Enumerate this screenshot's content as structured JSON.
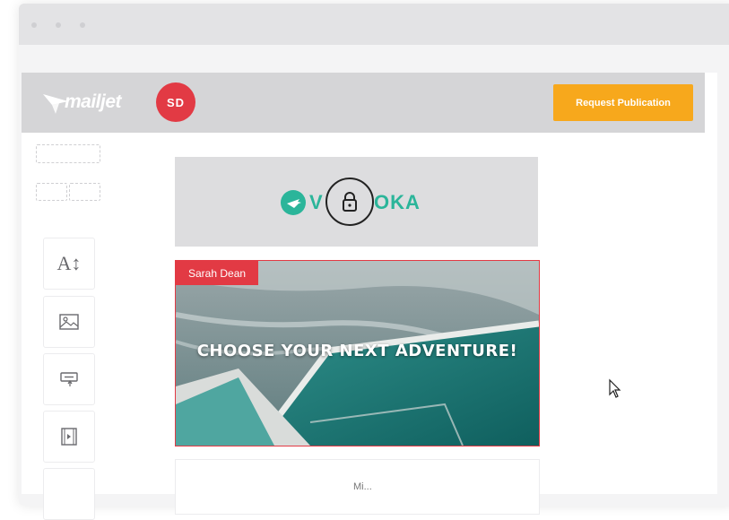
{
  "window": {
    "controls": [
      "close",
      "minimize",
      "maximize"
    ]
  },
  "header": {
    "logo_text": "mailjet",
    "avatar_initials": "SD",
    "publish_button": "Request Publication"
  },
  "sidebar": {
    "tools": [
      {
        "name": "text-tool",
        "label": "A↕",
        "icon": "text-icon"
      },
      {
        "name": "image-tool",
        "icon": "image-icon"
      },
      {
        "name": "button-tool",
        "icon": "button-icon"
      },
      {
        "name": "video-tool",
        "icon": "video-icon"
      }
    ]
  },
  "email": {
    "header_block": {
      "brand": "OKA",
      "brand_prefix": "V"
    },
    "hero": {
      "editing_user": "Sarah Dean",
      "title": "CHOOSE YOUR NEXT ADVENTURE!"
    },
    "next_block_text": "Mi..."
  },
  "colors": {
    "accent_red": "#e23a44",
    "publish_orange": "#f7a81c",
    "brand_green": "#2bb59a"
  }
}
